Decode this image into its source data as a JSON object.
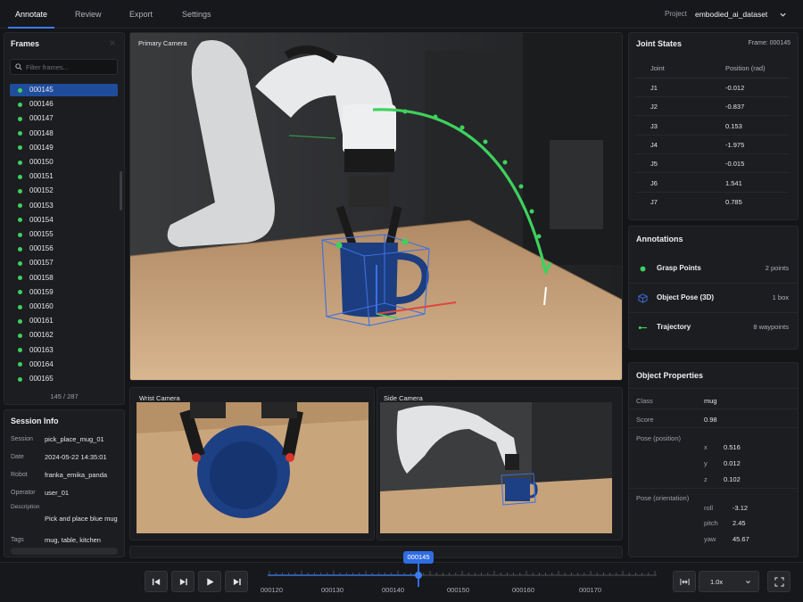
{
  "nav": {
    "tabs": [
      "Annotate",
      "Review",
      "Export",
      "Settings"
    ],
    "project_label": "Project",
    "project_value": "embodied_ai_dataset"
  },
  "frames": {
    "title": "Frames",
    "search_placeholder": "Filter frames...",
    "items": [
      "000145",
      "000146",
      "000147",
      "000148",
      "000149",
      "000150",
      "000151",
      "000152",
      "000153",
      "000154",
      "000155",
      "000156",
      "000157",
      "000158",
      "000159",
      "000160",
      "000161",
      "000162",
      "000163",
      "000164",
      "000165"
    ],
    "selected_index": 0,
    "count": "145 / 287"
  },
  "session": {
    "title": "Session Info",
    "rows": [
      {
        "key": "Session",
        "value": "pick_place_mug_01"
      },
      {
        "key": "Date",
        "value": "2024-05-22 14:35:01"
      },
      {
        "key": "Robot",
        "value": "franka_emika_panda"
      },
      {
        "key": "Operator",
        "value": "user_01"
      },
      {
        "key": "Description",
        "value": "Pick and place blue mug"
      },
      {
        "key": "Tags",
        "value": "mug, table, kitchen"
      }
    ]
  },
  "cameras": {
    "primary": "Primary Camera",
    "wrist": "Wrist Camera",
    "side": "Side Camera"
  },
  "joint_states": {
    "title": "Joint States",
    "frame_label": "Frame: 000145",
    "columns": [
      "Joint",
      "Position (rad)"
    ],
    "rows": [
      {
        "joint": "J1",
        "value": "-0.012"
      },
      {
        "joint": "J2",
        "value": "-0.837"
      },
      {
        "joint": "J3",
        "value": "0.153"
      },
      {
        "joint": "J4",
        "value": "-1.975"
      },
      {
        "joint": "J5",
        "value": "-0.015"
      },
      {
        "joint": "J6",
        "value": "1.541"
      },
      {
        "joint": "J7",
        "value": "0.785"
      }
    ]
  },
  "annotations": {
    "title": "Annotations",
    "items": [
      {
        "label": "Grasp Points",
        "count": "2 points",
        "icon": "dot-icon",
        "color": "#3ed15d"
      },
      {
        "label": "Object Pose (3D)",
        "count": "1 box",
        "icon": "cube-icon",
        "color": "#3d6fe0"
      },
      {
        "label": "Trajectory",
        "count": "8 waypoints",
        "icon": "trajectory-icon",
        "color": "#3ed15d"
      }
    ]
  },
  "object_properties": {
    "title": "Object Properties",
    "class_label": "Class",
    "class_value": "mug",
    "score_label": "Score",
    "score_value": "0.98",
    "position_label": "Pose (position)",
    "position": [
      {
        "axis": "x",
        "value": "0.516"
      },
      {
        "axis": "y",
        "value": "0.012"
      },
      {
        "axis": "z",
        "value": "0.102"
      }
    ],
    "orientation_label": "Pose (orientation)",
    "orientation": [
      {
        "axis": "roll",
        "value": "-3.12"
      },
      {
        "axis": "pitch",
        "value": "2.45"
      },
      {
        "axis": "yaw",
        "value": "45.67"
      }
    ]
  },
  "playback": {
    "current_frame": "000145",
    "timeline_labels": [
      "000120",
      "000130",
      "000140",
      "000150",
      "000160",
      "000170"
    ],
    "speed": "1.0x"
  },
  "colors": {
    "accent": "#2f6de1",
    "grasp": "#3ed15d",
    "box": "#3d6fe0"
  }
}
